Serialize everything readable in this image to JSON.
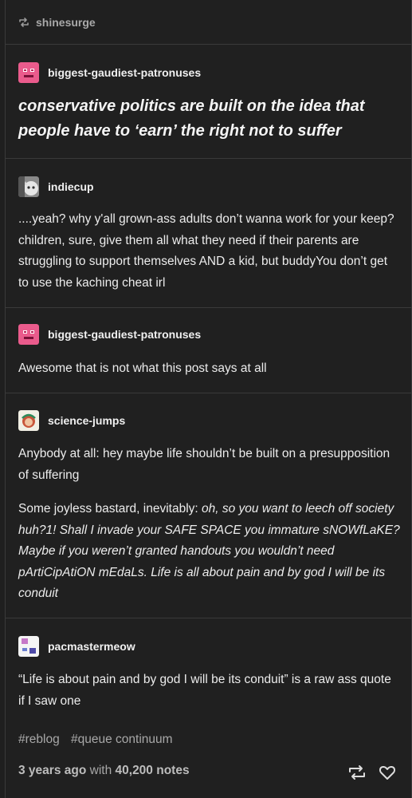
{
  "reblogged_by": "shinesurge",
  "posts": [
    {
      "username": "biggest-gaudiest-patronuses",
      "body": "conservative politics are built on the idea that people have to ‘earn’ the right not to suffer"
    },
    {
      "username": "indiecup",
      "body": "....yeah? why y'all grown-ass adults don’t wanna work for your keep? children, sure, give them all what they need if their parents are struggling to support themselves AND a kid, but buddyYou don’t get to use the kaching cheat irl"
    },
    {
      "username": "biggest-gaudiest-patronuses",
      "body": "Awesome that is not what this post says at all"
    },
    {
      "username": "science-jumps",
      "body": "Anybody at all: hey maybe life shouldn’t be built on a presupposition of suffering",
      "body2_prefix": "Some joyless bastard, inevitably: ",
      "body2_italic": "oh, so you want to leech off society huh?1! Shall I invade your SAFE SPACE you immature sNOWfLaKE? Maybe if you weren’t granted handouts you wouldn’t need pArtiCipAtiON mEdaLs. Life is all about pain and by god I will be its conduit"
    },
    {
      "username": "pacmastermeow",
      "body": "“Life is about pain and by god I will be its conduit” is a raw ass quote if I saw one"
    }
  ],
  "tags": [
    "#reblog",
    "#queue continuum"
  ],
  "footer": {
    "time": "3 years ago",
    "with": "with",
    "notes": "40,200 notes"
  },
  "colors": {
    "background": "#202020",
    "divider": "#3a3a3a",
    "avatar_pink": "#e85b8a"
  },
  "icons": {
    "reblog": "reblog-icon",
    "like": "heart-icon"
  }
}
